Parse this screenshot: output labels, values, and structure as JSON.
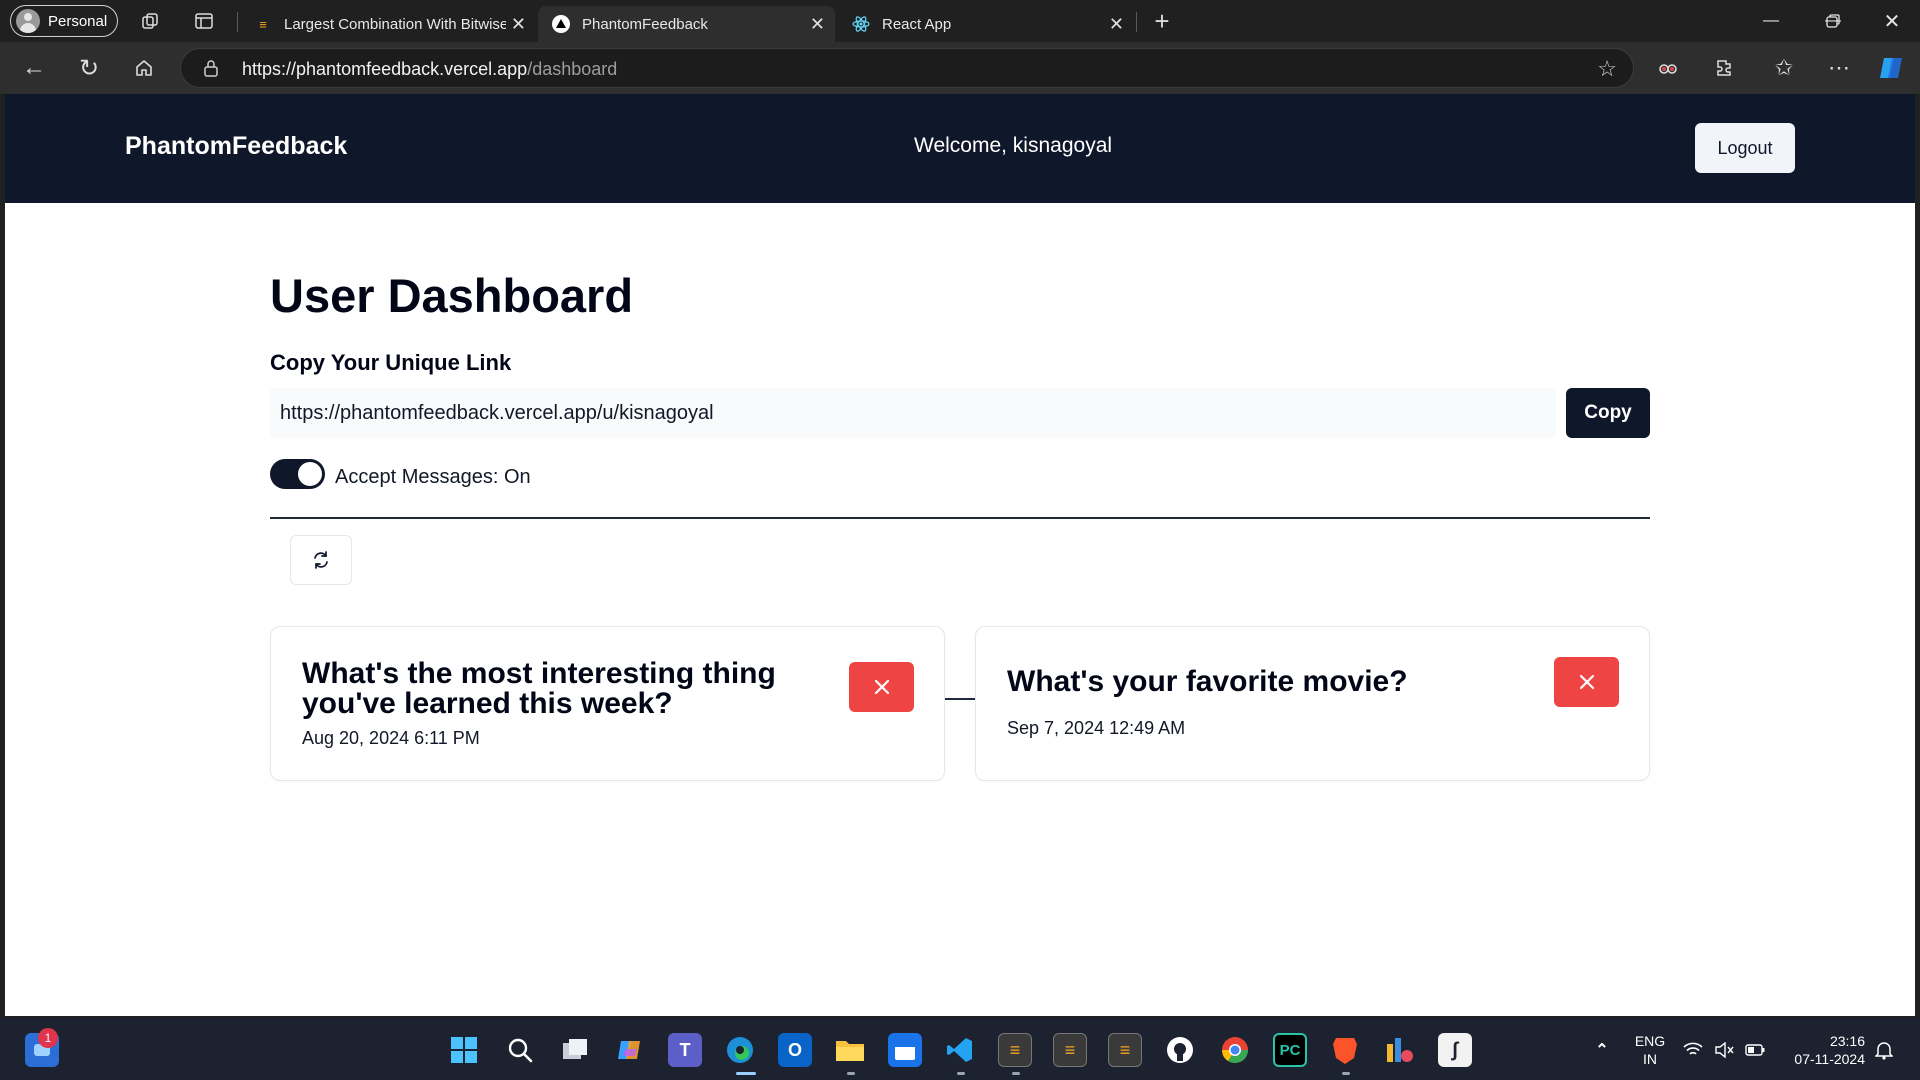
{
  "browser": {
    "profile_label": "Personal",
    "tabs": [
      {
        "title": "Largest Combination With Bitwise AND Greater Than Zero",
        "active": false
      },
      {
        "title": "PhantomFeedback",
        "active": true
      },
      {
        "title": "React App",
        "active": false
      }
    ],
    "url_host": "https://phantomfeedback.vercel.app",
    "url_path": "/dashboard"
  },
  "navbar": {
    "brand": "PhantomFeedback",
    "welcome": "Welcome, kisnagoyal",
    "logout_label": "Logout"
  },
  "dashboard": {
    "title": "User Dashboard",
    "link_heading": "Copy Your Unique Link",
    "unique_link": "https://phantomfeedback.vercel.app/u/kisnagoyal",
    "copy_label": "Copy",
    "accept_messages_label": "Accept Messages: On",
    "accept_messages": true
  },
  "messages": [
    {
      "content": "What's the most interesting thing you've learned this week?",
      "date": "Aug 20, 2024 6:11 PM"
    },
    {
      "content": "What's your favorite movie?",
      "date": "Sep 7, 2024 12:49 AM"
    }
  ],
  "taskbar": {
    "notification_count": "1",
    "language": "ENG",
    "region": "IN",
    "time": "23:16",
    "date": "07-11-2024"
  },
  "colors": {
    "navbar_bg": "#0f172a",
    "delete_button": "#ef4444",
    "primary": "#0f172a"
  }
}
